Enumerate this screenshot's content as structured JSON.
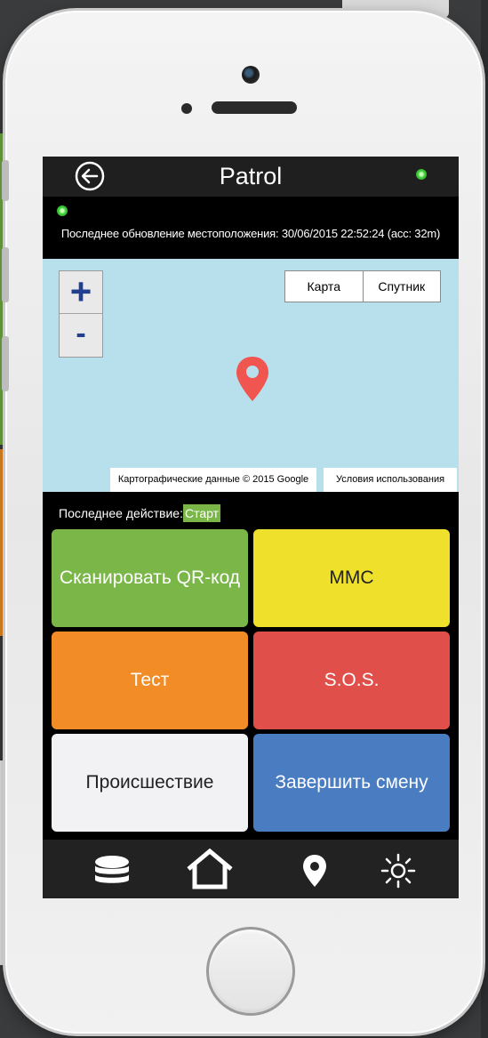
{
  "app": {
    "title": "Patrol"
  },
  "location": {
    "text": "Последнее обновление местоположения: 30/06/2015 22:52:24 (acc: 32m)"
  },
  "map": {
    "zoom_in": "+",
    "zoom_out": "-",
    "type_map": "Карта",
    "type_satellite": "Спутник",
    "attribution": "Картографические данные © 2015 Google",
    "terms": "Условия использования"
  },
  "last_action": {
    "label": "Последнее действие:",
    "value": "Старт"
  },
  "tiles": {
    "qr": "Сканировать QR-код",
    "mmc": "MMC",
    "test": "Тест",
    "sos": "S.O.S.",
    "incident": "Происшествие",
    "end_shift": "Завершить смену"
  },
  "nav": {
    "items": [
      "database-icon",
      "home-icon",
      "location-pin-icon",
      "brightness-icon"
    ]
  },
  "colors": {
    "green": "#7ab648",
    "yellow": "#efe12b",
    "orange": "#f28c26",
    "red": "#e04f4a",
    "blue": "#4a7cc2",
    "map_water": "#b7e0ec",
    "pin": "#f0554f"
  }
}
